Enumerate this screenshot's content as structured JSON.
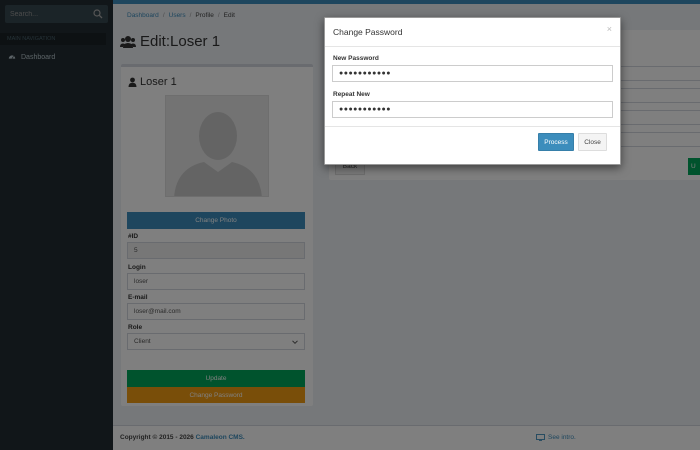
{
  "sidebar": {
    "search": {
      "placeholder": "Search...",
      "value": ""
    },
    "section_header": "MAIN NAVIGATION",
    "items": [
      {
        "label": "Dashboard",
        "icon": "dashboard-icon"
      }
    ]
  },
  "breadcrumb": {
    "items": [
      "Dashboard",
      "Users",
      "Profile",
      "Edit"
    ]
  },
  "page": {
    "title": "Edit:Loser 1",
    "title_icon": "users-icon"
  },
  "profile": {
    "heading": "Loser 1",
    "heading_icon": "user-icon",
    "change_photo_label": "Change Photo",
    "fields": {
      "id_label": "#ID",
      "id_value": "5",
      "login_label": "Login",
      "login_value": "loser",
      "email_label": "E-mail",
      "email_value": "loser@mail.com",
      "role_label": "Role",
      "role_value": "Client"
    },
    "update_label": "Update",
    "change_password_label": "Change Password"
  },
  "right_panel": {
    "back_label": "Back",
    "edge_button_label": "U"
  },
  "footer": {
    "copyright_prefix": "Copyright © 2015 - 2026 ",
    "brand": "Camaleon CMS.",
    "link_label": "See intro."
  },
  "modal": {
    "title": "Change Password",
    "close_glyph": "×",
    "new_password_label": "New Password",
    "new_password_value": "●●●●●●●●●●●",
    "repeat_label": "Repeat New",
    "repeat_value": "●●●●●●●●●●●",
    "process_label": "Process",
    "close_label": "Close"
  },
  "colors": {
    "accent": "#3c8dbc",
    "success": "#00a65a",
    "warning": "#f39c12",
    "sidebar_bg": "#222d32",
    "content_bg": "#ecf0f5"
  }
}
